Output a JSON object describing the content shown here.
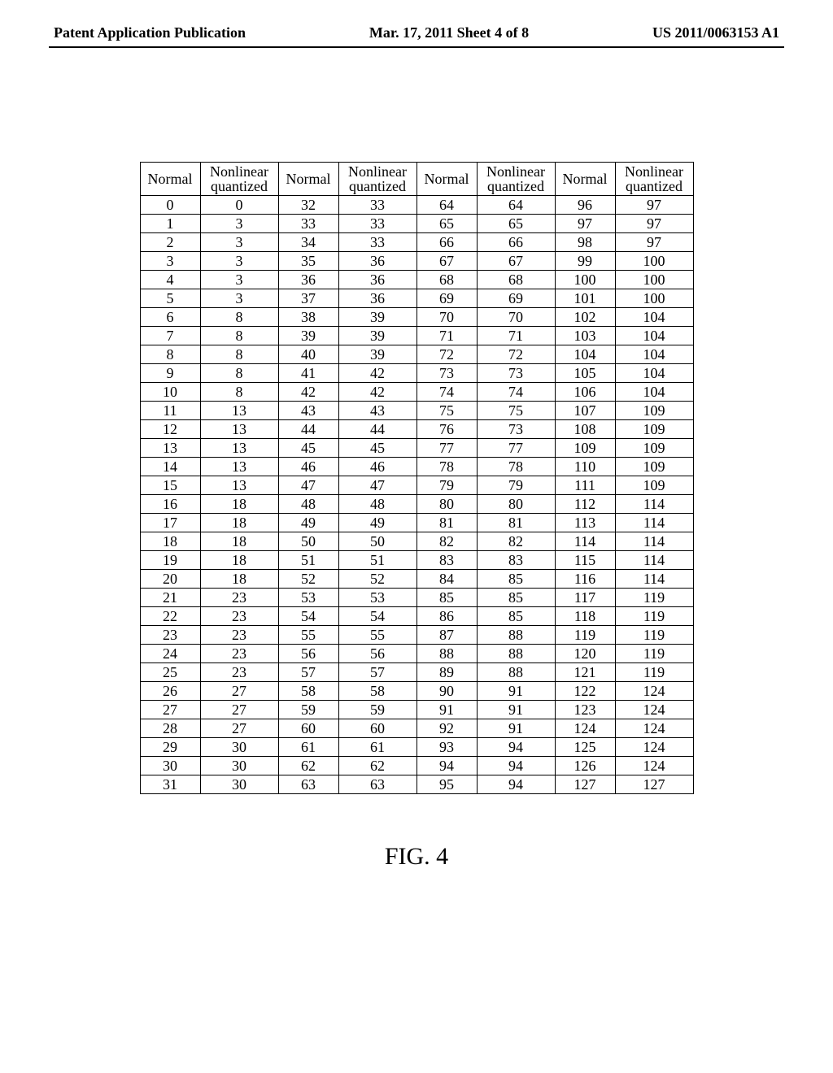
{
  "header": {
    "left": "Patent Application Publication",
    "center": "Mar. 17, 2011  Sheet 4 of 8",
    "right": "US 2011/0063153 A1"
  },
  "chart_data": {
    "type": "table",
    "title": "FIG. 4",
    "column_pairs": 4,
    "headers": {
      "normal": "Normal",
      "nonlinear_line1": "Nonlinear",
      "nonlinear_line2": "quantized"
    },
    "rows": [
      {
        "n1": 0,
        "q1": 0,
        "n2": 32,
        "q2": 33,
        "n3": 64,
        "q3": 64,
        "n4": 96,
        "q4": 97
      },
      {
        "n1": 1,
        "q1": 3,
        "n2": 33,
        "q2": 33,
        "n3": 65,
        "q3": 65,
        "n4": 97,
        "q4": 97
      },
      {
        "n1": 2,
        "q1": 3,
        "n2": 34,
        "q2": 33,
        "n3": 66,
        "q3": 66,
        "n4": 98,
        "q4": 97
      },
      {
        "n1": 3,
        "q1": 3,
        "n2": 35,
        "q2": 36,
        "n3": 67,
        "q3": 67,
        "n4": 99,
        "q4": 100
      },
      {
        "n1": 4,
        "q1": 3,
        "n2": 36,
        "q2": 36,
        "n3": 68,
        "q3": 68,
        "n4": 100,
        "q4": 100
      },
      {
        "n1": 5,
        "q1": 3,
        "n2": 37,
        "q2": 36,
        "n3": 69,
        "q3": 69,
        "n4": 101,
        "q4": 100
      },
      {
        "n1": 6,
        "q1": 8,
        "n2": 38,
        "q2": 39,
        "n3": 70,
        "q3": 70,
        "n4": 102,
        "q4": 104
      },
      {
        "n1": 7,
        "q1": 8,
        "n2": 39,
        "q2": 39,
        "n3": 71,
        "q3": 71,
        "n4": 103,
        "q4": 104
      },
      {
        "n1": 8,
        "q1": 8,
        "n2": 40,
        "q2": 39,
        "n3": 72,
        "q3": 72,
        "n4": 104,
        "q4": 104
      },
      {
        "n1": 9,
        "q1": 8,
        "n2": 41,
        "q2": 42,
        "n3": 73,
        "q3": 73,
        "n4": 105,
        "q4": 104
      },
      {
        "n1": 10,
        "q1": 8,
        "n2": 42,
        "q2": 42,
        "n3": 74,
        "q3": 74,
        "n4": 106,
        "q4": 104
      },
      {
        "n1": 11,
        "q1": 13,
        "n2": 43,
        "q2": 43,
        "n3": 75,
        "q3": 75,
        "n4": 107,
        "q4": 109
      },
      {
        "n1": 12,
        "q1": 13,
        "n2": 44,
        "q2": 44,
        "n3": 76,
        "q3": 73,
        "n4": 108,
        "q4": 109
      },
      {
        "n1": 13,
        "q1": 13,
        "n2": 45,
        "q2": 45,
        "n3": 77,
        "q3": 77,
        "n4": 109,
        "q4": 109
      },
      {
        "n1": 14,
        "q1": 13,
        "n2": 46,
        "q2": 46,
        "n3": 78,
        "q3": 78,
        "n4": 110,
        "q4": 109
      },
      {
        "n1": 15,
        "q1": 13,
        "n2": 47,
        "q2": 47,
        "n3": 79,
        "q3": 79,
        "n4": 111,
        "q4": 109
      },
      {
        "n1": 16,
        "q1": 18,
        "n2": 48,
        "q2": 48,
        "n3": 80,
        "q3": 80,
        "n4": 112,
        "q4": 114
      },
      {
        "n1": 17,
        "q1": 18,
        "n2": 49,
        "q2": 49,
        "n3": 81,
        "q3": 81,
        "n4": 113,
        "q4": 114
      },
      {
        "n1": 18,
        "q1": 18,
        "n2": 50,
        "q2": 50,
        "n3": 82,
        "q3": 82,
        "n4": 114,
        "q4": 114
      },
      {
        "n1": 19,
        "q1": 18,
        "n2": 51,
        "q2": 51,
        "n3": 83,
        "q3": 83,
        "n4": 115,
        "q4": 114
      },
      {
        "n1": 20,
        "q1": 18,
        "n2": 52,
        "q2": 52,
        "n3": 84,
        "q3": 85,
        "n4": 116,
        "q4": 114
      },
      {
        "n1": 21,
        "q1": 23,
        "n2": 53,
        "q2": 53,
        "n3": 85,
        "q3": 85,
        "n4": 117,
        "q4": 119
      },
      {
        "n1": 22,
        "q1": 23,
        "n2": 54,
        "q2": 54,
        "n3": 86,
        "q3": 85,
        "n4": 118,
        "q4": 119
      },
      {
        "n1": 23,
        "q1": 23,
        "n2": 55,
        "q2": 55,
        "n3": 87,
        "q3": 88,
        "n4": 119,
        "q4": 119
      },
      {
        "n1": 24,
        "q1": 23,
        "n2": 56,
        "q2": 56,
        "n3": 88,
        "q3": 88,
        "n4": 120,
        "q4": 119
      },
      {
        "n1": 25,
        "q1": 23,
        "n2": 57,
        "q2": 57,
        "n3": 89,
        "q3": 88,
        "n4": 121,
        "q4": 119
      },
      {
        "n1": 26,
        "q1": 27,
        "n2": 58,
        "q2": 58,
        "n3": 90,
        "q3": 91,
        "n4": 122,
        "q4": 124
      },
      {
        "n1": 27,
        "q1": 27,
        "n2": 59,
        "q2": 59,
        "n3": 91,
        "q3": 91,
        "n4": 123,
        "q4": 124
      },
      {
        "n1": 28,
        "q1": 27,
        "n2": 60,
        "q2": 60,
        "n3": 92,
        "q3": 91,
        "n4": 124,
        "q4": 124
      },
      {
        "n1": 29,
        "q1": 30,
        "n2": 61,
        "q2": 61,
        "n3": 93,
        "q3": 94,
        "n4": 125,
        "q4": 124
      },
      {
        "n1": 30,
        "q1": 30,
        "n2": 62,
        "q2": 62,
        "n3": 94,
        "q3": 94,
        "n4": 126,
        "q4": 124
      },
      {
        "n1": 31,
        "q1": 30,
        "n2": 63,
        "q2": 63,
        "n3": 95,
        "q3": 94,
        "n4": 127,
        "q4": 127
      }
    ]
  }
}
